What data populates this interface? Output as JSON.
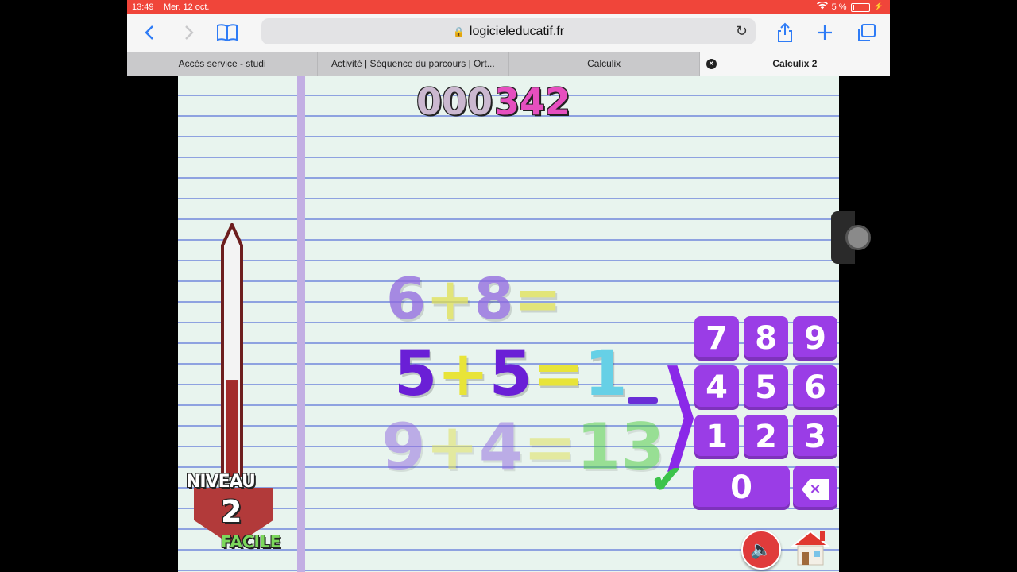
{
  "status_bar": {
    "time": "13:49",
    "date": "Mer. 12 oct.",
    "battery": "5 %"
  },
  "browser": {
    "url": "logicieleducatif.fr",
    "icons": [
      "back-icon",
      "forward-icon",
      "bookmarks-icon",
      "lock-icon",
      "reload-icon",
      "share-icon",
      "new-tab-icon",
      "tabs-icon"
    ],
    "tabs": [
      {
        "label": "Accès service - studi",
        "active": false
      },
      {
        "label": "Activité | Séquence du parcours | Ort...",
        "active": false
      },
      {
        "label": "Calculix",
        "active": false
      },
      {
        "label": "Calculix 2",
        "active": true
      }
    ]
  },
  "game": {
    "score": {
      "dim_digits": "000",
      "lit_digits": "342"
    },
    "equations": [
      {
        "a": "6",
        "op": "+",
        "b": "8",
        "eq": "=",
        "answer": ""
      },
      {
        "a": "5",
        "op": "+",
        "b": "5",
        "eq": "=",
        "answer": "1"
      },
      {
        "a": "9",
        "op": "+",
        "b": "4",
        "eq": "=",
        "answer": "13"
      }
    ],
    "keypad": [
      "7",
      "8",
      "9",
      "4",
      "5",
      "6",
      "1",
      "2",
      "3",
      "0"
    ],
    "level": {
      "label": "NIVEAU",
      "number": "2",
      "difficulty": "FACILE"
    },
    "thermometer_fill": 0.42,
    "colors": {
      "keypad": "#9a3de6",
      "thermo_fill": "#a32b2b",
      "paper": "#e8f4ee"
    }
  }
}
